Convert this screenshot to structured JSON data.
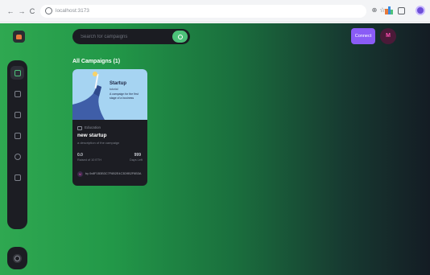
{
  "browser": {
    "back_glyph": "←",
    "forward_glyph": "→",
    "reload_glyph": "C",
    "url": "localhost:3173",
    "zoom_glyph": "⊕",
    "star_glyph": "☆"
  },
  "header": {
    "search": {
      "placeholder": "Search for campaigns"
    },
    "connect_label": "Connect",
    "avatar_mark": "M"
  },
  "main": {
    "section_title": "All Campaigns (1)"
  },
  "campaign": {
    "image": {
      "title": "Startup",
      "subtitle": "tutorial",
      "text": "A campaign for the first stage of a business"
    },
    "category": "Education",
    "title": "new startup",
    "description": "a description of the campaign",
    "raised_value": "0.0",
    "raised_label": "Raised of 10 ETH",
    "days_value": "999",
    "days_label": "Days Left",
    "owner_initial": "M",
    "owner_address": "by 0x8F1B3B3C7F6B2E4C3D9B2F6B3A"
  },
  "colors": {
    "accent_green": "#4dc27a",
    "connect_purple": "#8a5cf6",
    "card_bg": "#1c1d23",
    "image_bg": "#a6d4f2"
  },
  "icons": {
    "sidebar": [
      "dashboard-icon",
      "campaign-icon",
      "payment-icon",
      "withdraw-icon",
      "profile-icon",
      "logout-icon"
    ],
    "theme": "sun-icon"
  }
}
